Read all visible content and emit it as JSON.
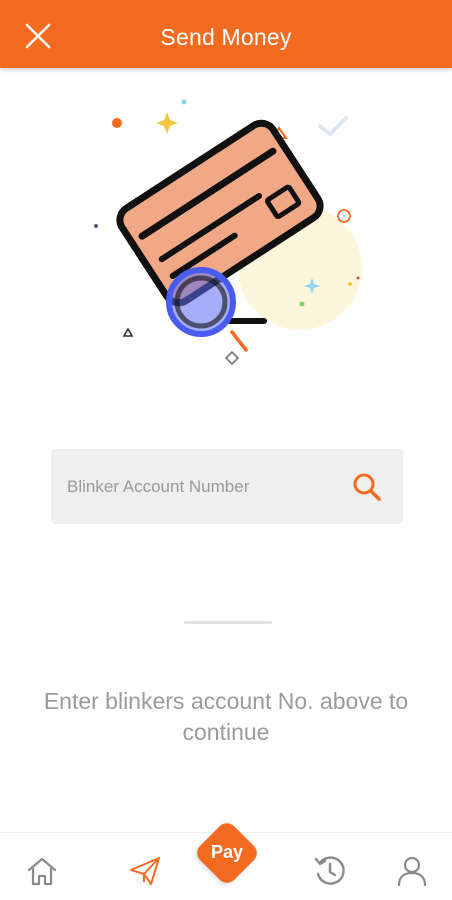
{
  "header": {
    "title": "Send Money",
    "close_icon": "close-icon",
    "background": "#f26b21"
  },
  "illustration": {
    "description_icon": "credit-card-search-icon"
  },
  "search": {
    "placeholder": "Blinker Account Number",
    "value": "",
    "icon": "search-icon"
  },
  "hint": {
    "text": "Enter blinkers account No. above to continue"
  },
  "bottom_nav": {
    "items": [
      {
        "icon": "home-icon"
      },
      {
        "icon": "send-icon"
      },
      {
        "icon": "history-icon"
      },
      {
        "icon": "profile-icon"
      }
    ],
    "pay_label": "Pay",
    "accent": "#f26b21"
  }
}
